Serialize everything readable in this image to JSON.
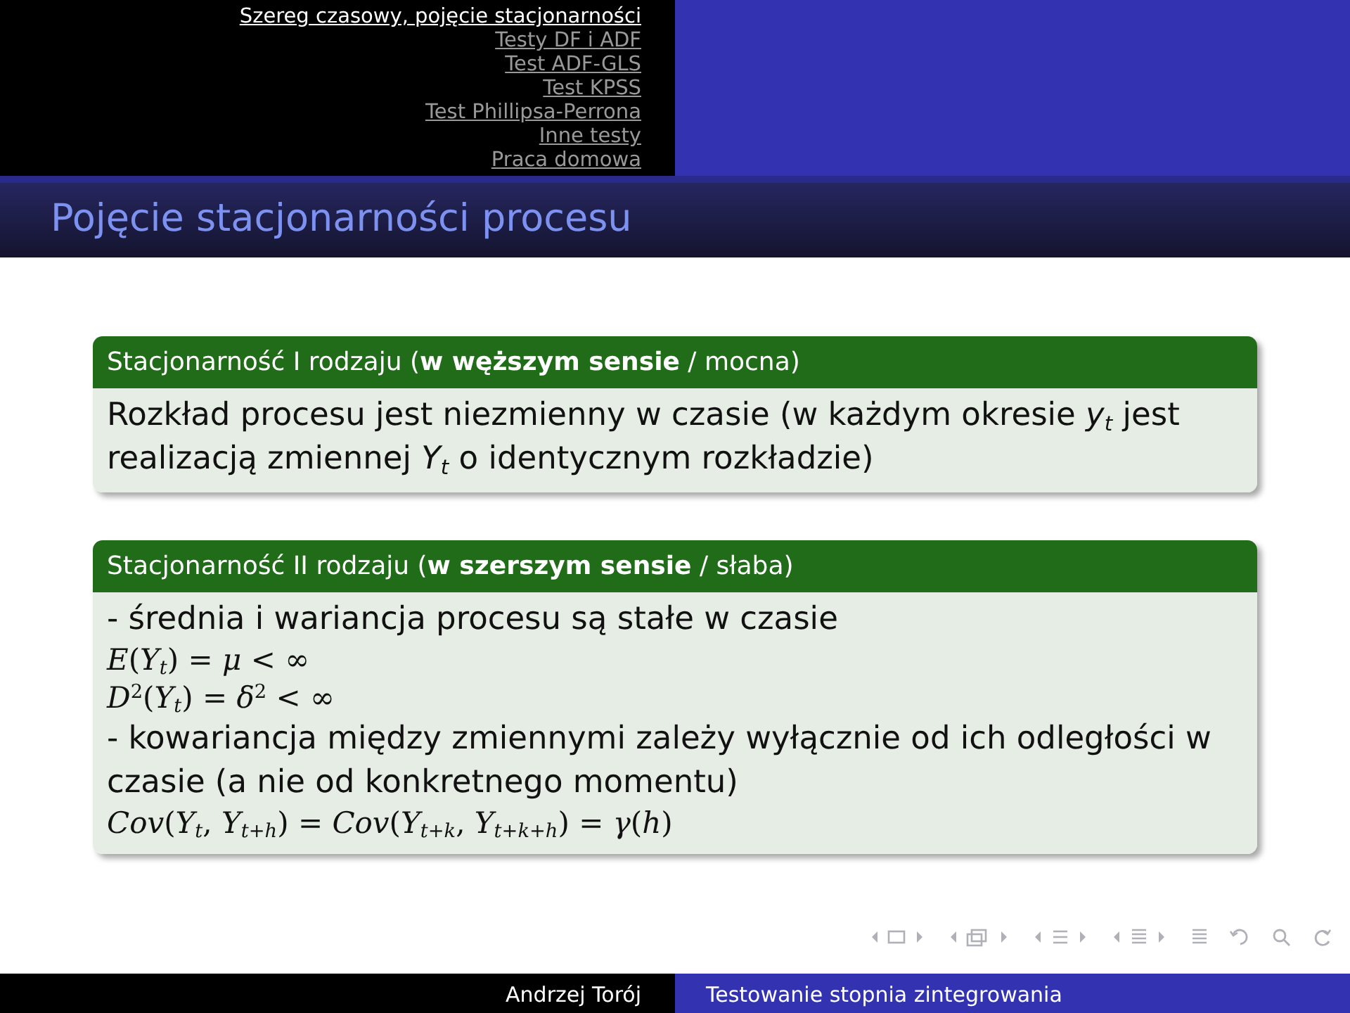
{
  "header": {
    "sections": [
      {
        "label": "Szereg czasowy, pojęcie stacjonarności",
        "selected": true
      },
      {
        "label": "Testy DF i ADF",
        "selected": false
      },
      {
        "label": "Test ADF-GLS",
        "selected": false
      },
      {
        "label": "Test KPSS",
        "selected": false
      },
      {
        "label": "Test Phillipsa-Perrona",
        "selected": false
      },
      {
        "label": "Inne testy",
        "selected": false
      },
      {
        "label": "Praca domowa",
        "selected": false
      }
    ]
  },
  "frame_title": "Pojęcie stacjonarności procesu",
  "blocks": [
    {
      "title": "Stacjonarność I rodzaju (**w węższym sensie** / mocna)",
      "lines": [
        {
          "kind": "text",
          "text": "Rozkład procesu jest niezmienny w czasie (w każdym okresie *y*$_{t}$ jest realizacją zmiennej *Y*$_{t}$ o identycznym rozkładzie)"
        }
      ]
    },
    {
      "title": "Stacjonarność II rodzaju (**w szerszym sensie** / słaba)",
      "lines": [
        {
          "kind": "text",
          "text": "- średnia i wariancja procesu są stałe w czasie"
        },
        {
          "kind": "formula",
          "text": "*E*(*Y*$_{t}$) = *μ* < ∞"
        },
        {
          "kind": "formula",
          "text": "*D*$^{2}$(*Y*$_{t}$) = *δ*$^{2}$ < ∞"
        },
        {
          "kind": "text",
          "text": "- kowariancja między zmiennymi zależy wyłącznie od ich odległości w czasie (a nie od konkretnego momentu)"
        },
        {
          "kind": "formula",
          "text": "*Cov*(*Y*$_{t}$, *Y*$_{t+h}$) = *Cov*(*Y*$_{t+k}$, *Y*$_{t+k+h}$) = *γ*(*h*)"
        }
      ]
    }
  ],
  "footer": {
    "author": "Andrzej Torój",
    "title": "Testowanie stopnia zintegrowania"
  }
}
